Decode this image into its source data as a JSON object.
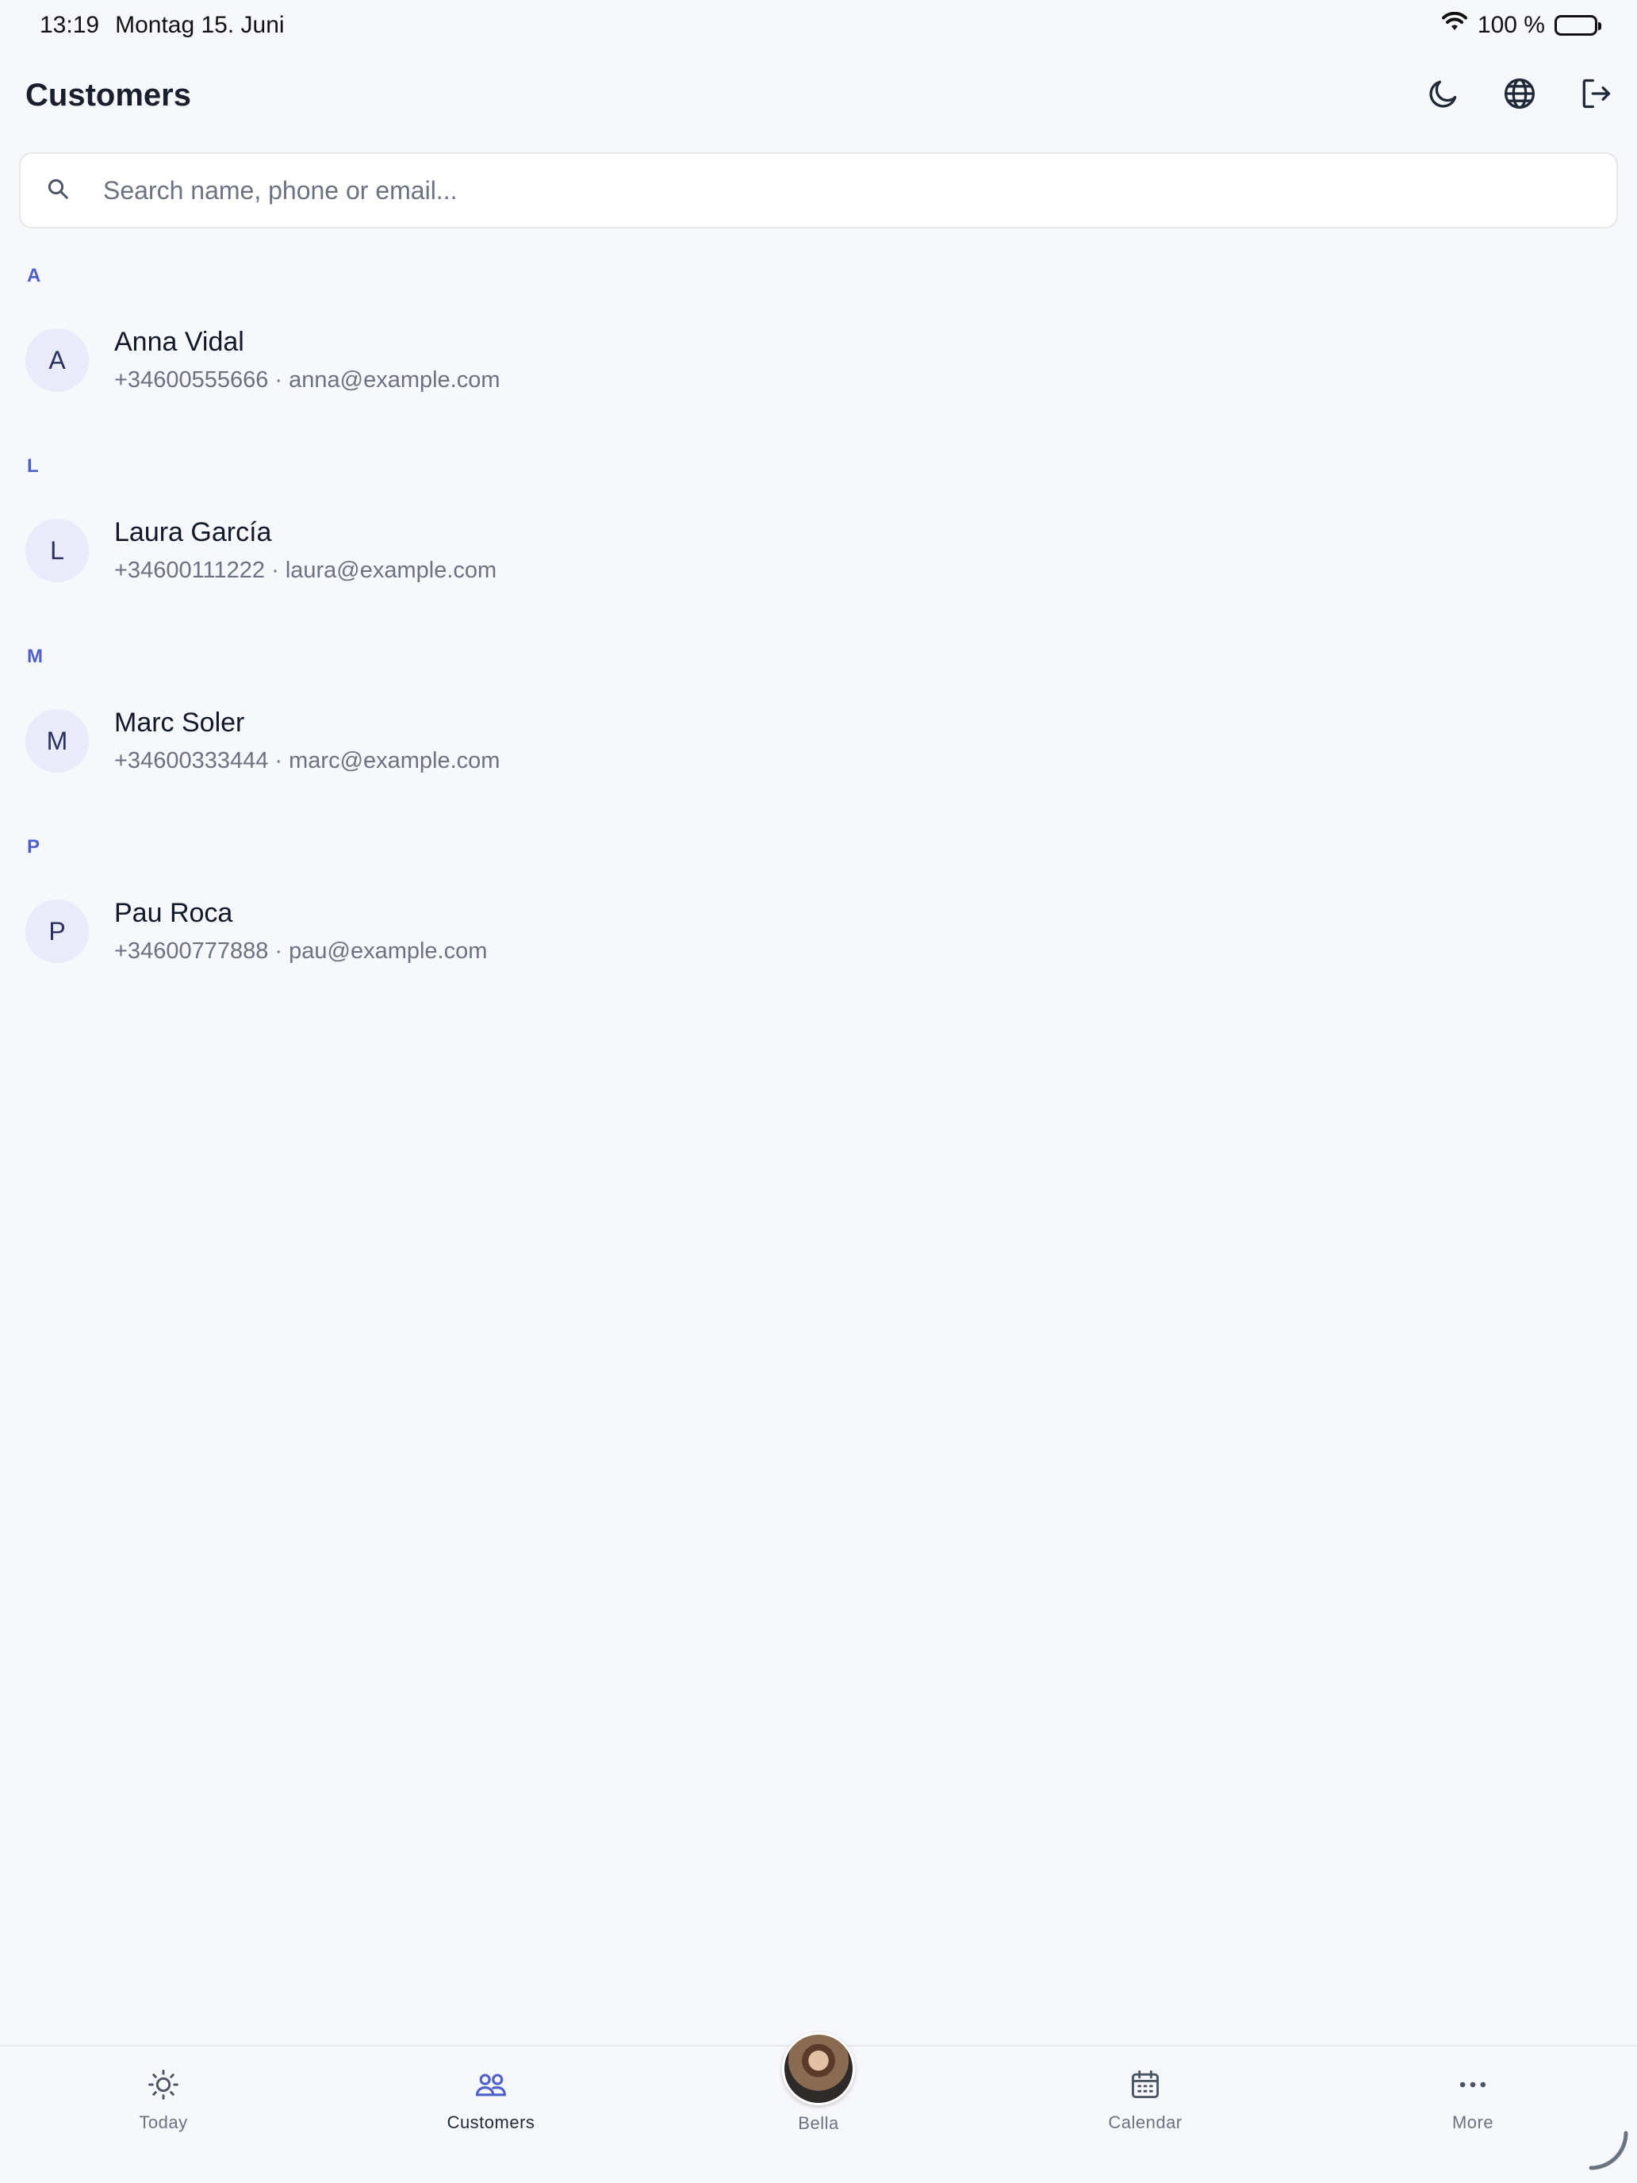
{
  "status_bar": {
    "time": "13:19",
    "date": "Montag 15. Juni",
    "battery": "100 %",
    "battery_level": 1.0
  },
  "header": {
    "title": "Customers"
  },
  "search": {
    "placeholder": "Search name, phone or email..."
  },
  "customers": {
    "sections": [
      {
        "letter": "A",
        "items": [
          {
            "initial": "A",
            "name": "Anna Vidal",
            "subtitle": "+34600555666 · anna@example.com"
          }
        ]
      },
      {
        "letter": "L",
        "items": [
          {
            "initial": "L",
            "name": "Laura García",
            "subtitle": "+34600111222 · laura@example.com"
          }
        ]
      },
      {
        "letter": "M",
        "items": [
          {
            "initial": "M",
            "name": "Marc Soler",
            "subtitle": "+34600333444 · marc@example.com"
          }
        ]
      },
      {
        "letter": "P",
        "items": [
          {
            "initial": "P",
            "name": "Pau Roca",
            "subtitle": "+34600777888 · pau@example.com"
          }
        ]
      }
    ]
  },
  "nav": {
    "today": "Today",
    "customers": "Customers",
    "profile": "Bella",
    "calendar": "Calendar",
    "more": "More"
  },
  "colors": {
    "accent": "#4f5fc9",
    "avatar_bg": "#e9eafa",
    "background": "#f7f8fb"
  },
  "icons": [
    "moon-icon",
    "globe-icon",
    "logout-icon",
    "search-icon",
    "sun-icon",
    "users-icon",
    "calendar-icon",
    "more-icon",
    "wifi-icon"
  ]
}
